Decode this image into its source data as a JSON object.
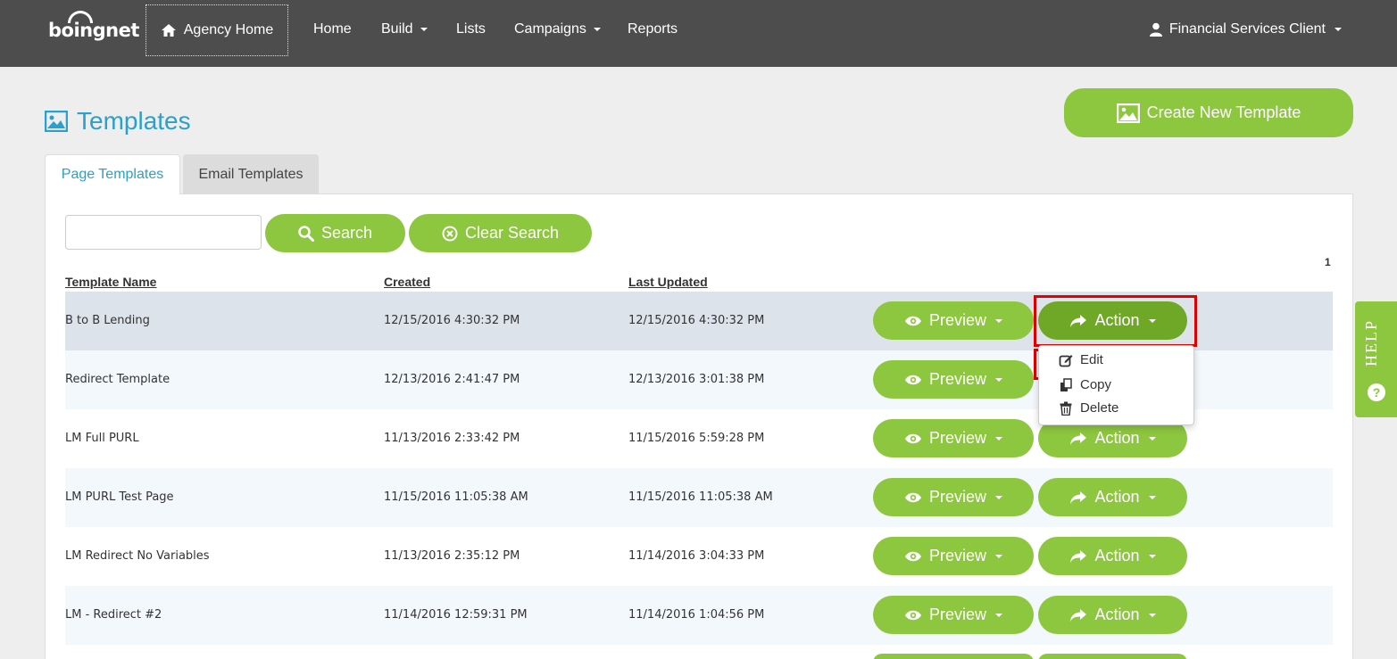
{
  "nav": {
    "logo": "boingnet",
    "agency_home": "Agency Home",
    "items": [
      "Home",
      "Build",
      "Lists",
      "Campaigns",
      "Reports"
    ],
    "user": "Financial Services Client"
  },
  "page": {
    "title": "Templates",
    "create_button": "Create New Template"
  },
  "tabs": [
    "Page Templates",
    "Email Templates"
  ],
  "search": {
    "value": "",
    "search_label": "Search",
    "clear_label": "Clear Search"
  },
  "pagination": "1",
  "columns": [
    "Template Name",
    "Created",
    "Last Updated"
  ],
  "rows": [
    {
      "name": "B to B Lending",
      "created": "12/15/2016 4:30:32 PM",
      "updated": "12/15/2016 4:30:32 PM"
    },
    {
      "name": "Redirect Template",
      "created": "12/13/2016 2:41:47 PM",
      "updated": "12/13/2016 3:01:38 PM"
    },
    {
      "name": "LM Full PURL",
      "created": "11/13/2016 2:33:42 PM",
      "updated": "11/15/2016 5:59:28 PM"
    },
    {
      "name": "LM PURL Test Page",
      "created": "11/15/2016 11:05:38 AM",
      "updated": "11/15/2016 11:05:38 AM"
    },
    {
      "name": "LM Redirect No Variables",
      "created": "11/13/2016 2:35:12 PM",
      "updated": "11/14/2016 3:04:33 PM"
    },
    {
      "name": "LM - Redirect #2",
      "created": "11/14/2016 12:59:31 PM",
      "updated": "11/14/2016 1:04:56 PM"
    }
  ],
  "row_buttons": {
    "preview": "Preview",
    "action": "Action"
  },
  "action_menu": [
    "Edit",
    "Copy",
    "Delete"
  ],
  "help": "HELP",
  "colors": {
    "navbar": "#4d4d4d",
    "accent_green": "#8dc63f",
    "title_blue": "#2aa0cc",
    "highlight_red": "#e00000"
  }
}
